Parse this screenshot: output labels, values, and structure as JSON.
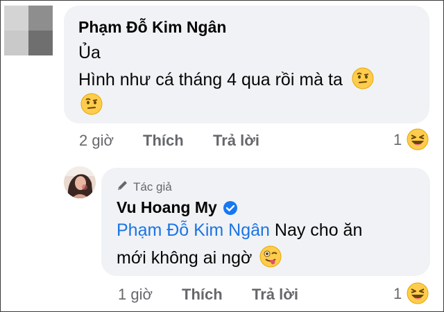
{
  "comment1": {
    "author": "Phạm Đỗ Kim Ngân",
    "line1": "Ủa",
    "line2": "Hình như cá tháng 4 qua rồi mà ta",
    "time": "2 giờ",
    "like_label": "Thích",
    "reply_label": "Trả lời",
    "reaction_count": "1",
    "reaction_icon": "laughing-emoji"
  },
  "reply1": {
    "badge_label": "Tác giả",
    "author": "Vu Hoang My",
    "mention": "Phạm Đỗ Kim Ngân",
    "text_part1": " Nay cho ăn",
    "text_part2": "mới không ai ngờ",
    "time": "1 giờ",
    "like_label": "Thích",
    "reply_label": "Trả lời",
    "reaction_count": "1",
    "reaction_icon": "laughing-emoji"
  },
  "colors": {
    "bubble": "#f0f2f5",
    "mention": "#1b74e4",
    "meta": "#65676b",
    "verified": "#1877f2"
  }
}
